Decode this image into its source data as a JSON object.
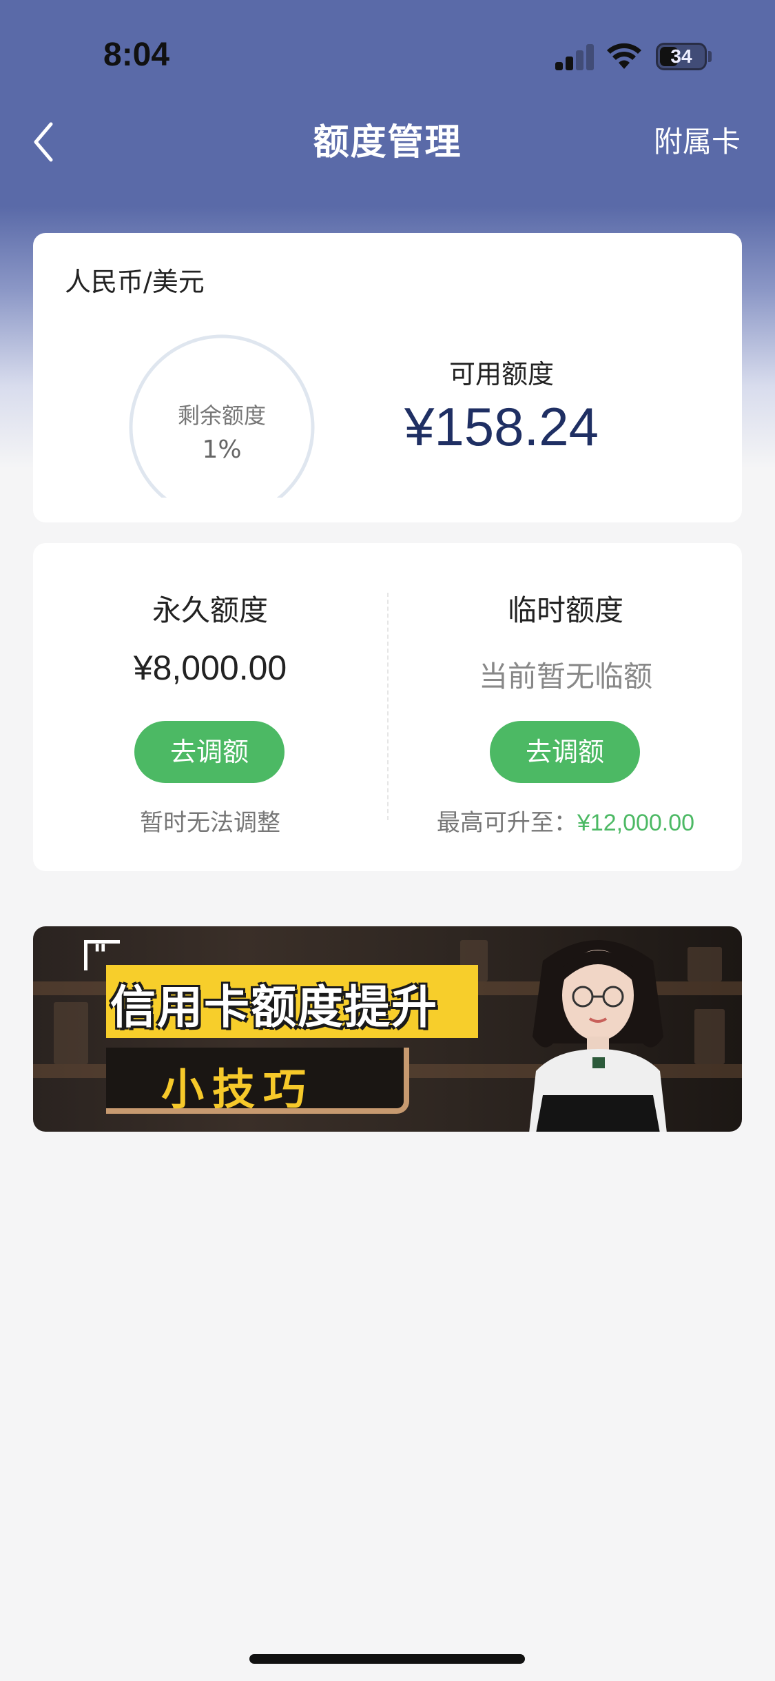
{
  "status_bar": {
    "time": "8:04",
    "battery": "34"
  },
  "nav": {
    "title": "额度管理",
    "right_action": "附属卡"
  },
  "available_card": {
    "currency": "人民币/美元",
    "gauge_label": "剩余额度",
    "gauge_percent": "1%",
    "gauge_fraction": 0.01,
    "available_label": "可用额度",
    "available_amount": "¥158.24"
  },
  "limits_card": {
    "permanent": {
      "title": "永久额度",
      "value": "¥8,000.00",
      "button": "去调额",
      "note": "暂时无法调整"
    },
    "temporary": {
      "title": "临时额度",
      "value": "当前暂无临额",
      "button": "去调额",
      "note_prefix": "最高可升至：",
      "note_amount": "¥12,000.00"
    }
  },
  "banner": {
    "title": "信用卡额度提升",
    "subtitle": "小技巧"
  },
  "colors": {
    "header_blue": "#5a6aa8",
    "accent_green": "#4cb964",
    "amount_navy": "#1f2f63",
    "banner_yellow": "#f7ce2b"
  }
}
